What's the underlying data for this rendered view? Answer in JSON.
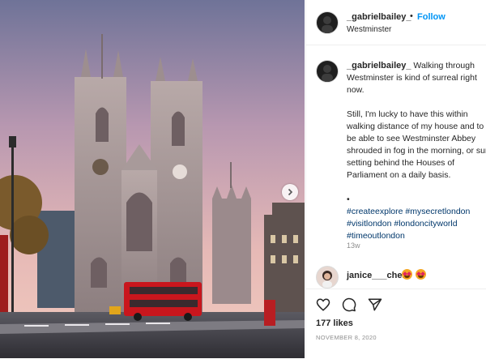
{
  "post": {
    "author": "_gabrielbailey_",
    "follow_label": "Follow",
    "separator": "•",
    "location": "Westminster",
    "caption": {
      "line1": "Walking through Westminster is kind of surreal right now.",
      "line2": "Still, I'm lucky to have this within walking distance of my house and to be able to see Westminster Abbey shrouded in fog in the morning, or sun setting behind the Houses of Parliament on a daily basis.",
      "bullet": "•",
      "hashtags": [
        "#createexplore",
        "#mysecretlondon",
        "#visitlondon",
        "#londoncityworld",
        "#timeoutlondon"
      ]
    },
    "age": "13w",
    "likes": "177 likes",
    "date": "NOVEMBER 8, 2020"
  },
  "comment": {
    "user": "janice___chen",
    "emojis": [
      "heart-eyes",
      "heart-eyes"
    ]
  },
  "icons": {
    "like": "heart-icon",
    "comment": "comment-icon",
    "share": "share-icon",
    "next": "chevron-right-icon"
  },
  "colors": {
    "follow": "#0095f6",
    "hashtag": "#00376b",
    "muted": "#8e8e8e"
  }
}
